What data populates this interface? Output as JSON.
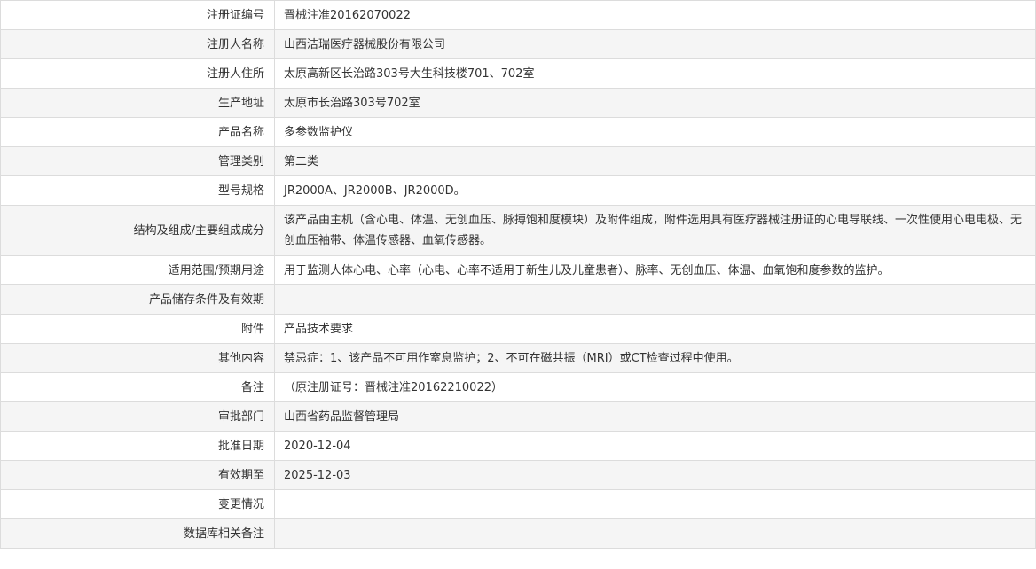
{
  "rows": [
    {
      "label": "注册证编号",
      "value": "晋械注准20162070022"
    },
    {
      "label": "注册人名称",
      "value": "山西洁瑞医疗器械股份有限公司"
    },
    {
      "label": "注册人住所",
      "value": "太原高新区长治路303号大生科技楼701、702室"
    },
    {
      "label": "生产地址",
      "value": "太原市长治路303号702室"
    },
    {
      "label": "产品名称",
      "value": "多参数监护仪"
    },
    {
      "label": "管理类别",
      "value": "第二类"
    },
    {
      "label": "型号规格",
      "value": "JR2000A、JR2000B、JR2000D。"
    },
    {
      "label": "结构及组成/主要组成成分",
      "value": "该产品由主机（含心电、体温、无创血压、脉搏饱和度模块）及附件组成，附件选用具有医疗器械注册证的心电导联线、一次性使用心电电极、无创血压袖带、体温传感器、血氧传感器。"
    },
    {
      "label": "适用范围/预期用途",
      "value": "用于监测人体心电、心率（心电、心率不适用于新生儿及儿童患者）、脉率、无创血压、体温、血氧饱和度参数的监护。"
    },
    {
      "label": "产品储存条件及有效期",
      "value": ""
    },
    {
      "label": "附件",
      "value": "产品技术要求"
    },
    {
      "label": "其他内容",
      "value": "禁忌症：1、该产品不可用作窒息监护；2、不可在磁共振（MRI）或CT检查过程中使用。"
    },
    {
      "label": "备注",
      "value": "（原注册证号：晋械注准20162210022）"
    },
    {
      "label": "审批部门",
      "value": "山西省药品监督管理局"
    },
    {
      "label": "批准日期",
      "value": "2020-12-04"
    },
    {
      "label": "有效期至",
      "value": "2025-12-03"
    },
    {
      "label": "变更情况",
      "value": ""
    },
    {
      "label": "数据库相关备注",
      "value": ""
    }
  ]
}
